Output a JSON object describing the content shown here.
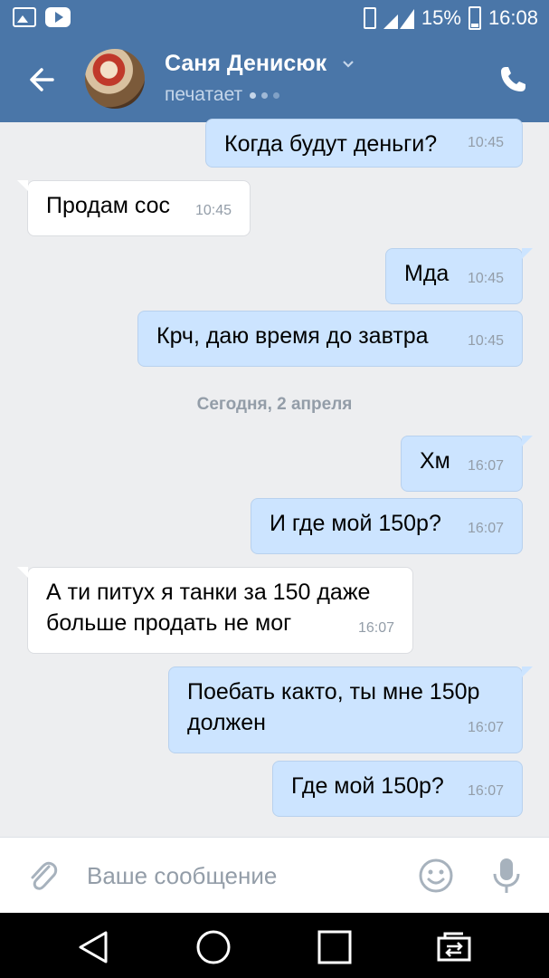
{
  "status_bar": {
    "battery": "15%",
    "time": "16:08",
    "network": "4G+"
  },
  "header": {
    "contact_name": "Саня Денисюк",
    "status": "печатает"
  },
  "messages": [
    {
      "dir": "out",
      "text": "Когда будут деньги?",
      "time": "10:45"
    },
    {
      "dir": "in",
      "text": "Продам сос",
      "time": "10:45"
    },
    {
      "dir": "out",
      "text": "Мда",
      "time": "10:45"
    },
    {
      "dir": "out",
      "text": "Крч, даю время до завтра",
      "time": "10:45"
    },
    {
      "dir": "out",
      "text": "Хм",
      "time": "16:07"
    },
    {
      "dir": "out",
      "text": "И где мой 150р?",
      "time": "16:07"
    },
    {
      "dir": "in",
      "text": "А ти питух я танки за 150 даже\nбольше продать не мог",
      "time": "16:07"
    },
    {
      "dir": "out",
      "text": "Поебать както, ты мне 150р\nдолжен",
      "time": "16:07"
    },
    {
      "dir": "out",
      "text": "Где мой 150р?",
      "time": "16:07"
    }
  ],
  "date_separator": "Сегодня, 2 апреля",
  "composer": {
    "placeholder": "Ваше сообщение"
  },
  "colors": {
    "header": "#4a76a8",
    "outgoing_bubble": "#cce4ff",
    "incoming_bubble": "#ffffff",
    "background": "#edeef0"
  }
}
